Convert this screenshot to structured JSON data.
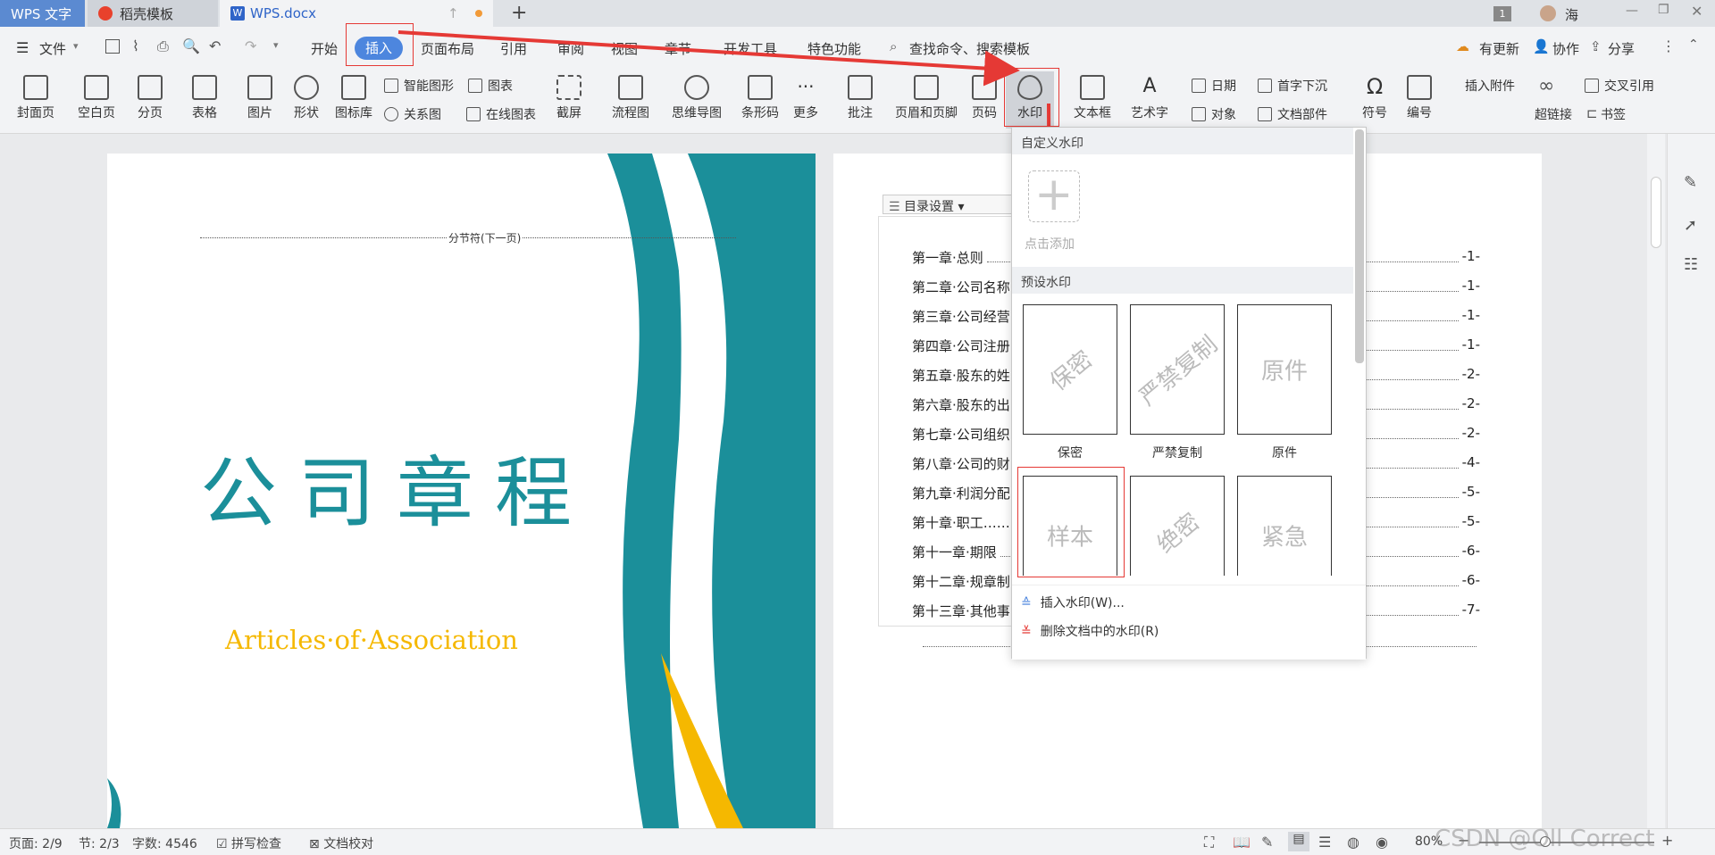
{
  "titlebar": {
    "tabs": [
      {
        "label": "WPS 文字"
      },
      {
        "label": "稻壳模板"
      },
      {
        "label": "WPS.docx"
      }
    ],
    "page_badge": "1",
    "user": "海"
  },
  "menubar": {
    "file": "文件",
    "items": [
      "开始",
      "插入",
      "页面布局",
      "引用",
      "审阅",
      "视图",
      "章节",
      "开发工具",
      "特色功能"
    ],
    "search": "查找命令、搜索模板",
    "right": [
      "有更新",
      "协作",
      "分享"
    ]
  },
  "ribbon": {
    "big": [
      "封面页",
      "空白页",
      "分页",
      "表格",
      "图片",
      "形状",
      "图标库",
      "流程图",
      "思维导图",
      "条形码",
      "更多",
      "批注",
      "页眉和页脚",
      "页码",
      "水印",
      "文本框",
      "艺术字",
      "符号",
      "编号"
    ],
    "small": [
      "智能图形",
      "图表",
      "关系图",
      "在线图表",
      "截屏",
      "日期",
      "首字下沉",
      "对象",
      "文档部件",
      "插入附件",
      "交叉引用",
      "超链接",
      "书签"
    ]
  },
  "page1": {
    "section_break": "分节符(下一页)",
    "title": "公司章程",
    "subtitle": "Articles·of·Association"
  },
  "page2": {
    "toc_tools": [
      "目录设置"
    ],
    "toc": [
      {
        "title": "第一章·总则",
        "page": "-1-"
      },
      {
        "title": "第二章·公司名称",
        "page": "-1-"
      },
      {
        "title": "第三章·公司经营",
        "page": "-1-"
      },
      {
        "title": "第四章·公司注册",
        "page": "-1-"
      },
      {
        "title": "第五章·股东的姓",
        "page": "-2-"
      },
      {
        "title": "第六章·股东的出",
        "page": "-2-"
      },
      {
        "title": "第七章·公司组织",
        "page": "-2-"
      },
      {
        "title": "第八章·公司的财",
        "page": "-4-"
      },
      {
        "title": "第九章·利润分配",
        "page": "-5-"
      },
      {
        "title": "第十章·职工……",
        "page": "-5-"
      },
      {
        "title": "第十一章·期限",
        "page": "-6-"
      },
      {
        "title": "第十二章·规章制",
        "page": "-6-"
      },
      {
        "title": "第十三章·其他事",
        "page": "-7-"
      }
    ]
  },
  "watermark_menu": {
    "custom_header": "自定义水印",
    "add_label": "点击添加",
    "preset_header": "预设水印",
    "presets": [
      {
        "text": "保密",
        "label": "保密"
      },
      {
        "text": "严禁复制",
        "label": "严禁复制"
      },
      {
        "text": "原件",
        "label": "原件"
      },
      {
        "text": "样本",
        "label": ""
      },
      {
        "text": "绝密",
        "label": ""
      },
      {
        "text": "紧急",
        "label": ""
      }
    ],
    "insert": "插入水印(W)...",
    "delete": "删除文档中的水印(R)"
  },
  "statusbar": {
    "page": "页面: 2/9",
    "section": "节: 2/3",
    "words": "字数: 4546",
    "spell": "拼写检查",
    "proof": "文档校对",
    "zoom": "80%"
  },
  "watermark_credit": "CSDN @Oll Correct",
  "colors": {
    "teal": "#1b8f9a",
    "gold": "#f5b800",
    "accent": "#3a73d9",
    "highlight": "#e53935"
  }
}
